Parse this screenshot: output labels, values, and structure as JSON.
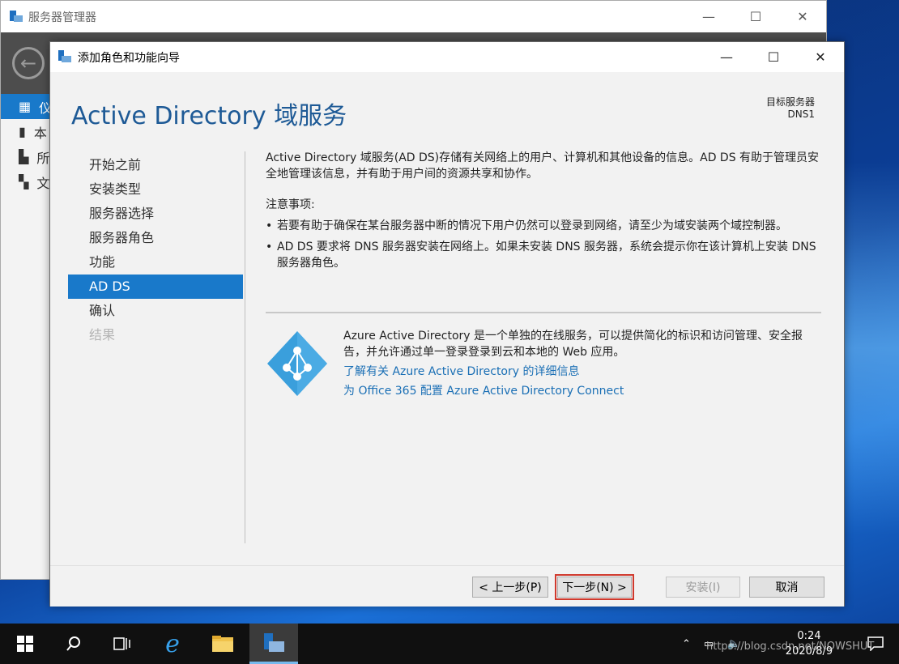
{
  "background_window": {
    "title": "服务器管理器",
    "sidebar_items": [
      "仪",
      "本",
      "所",
      "文"
    ]
  },
  "wizard": {
    "title": "添加角色和功能向导",
    "heading": "Active Directory 域服务",
    "target_label": "目标服务器",
    "target_value": "DNS1",
    "nav": [
      {
        "label": "开始之前",
        "state": "normal"
      },
      {
        "label": "安装类型",
        "state": "normal"
      },
      {
        "label": "服务器选择",
        "state": "normal"
      },
      {
        "label": "服务器角色",
        "state": "normal"
      },
      {
        "label": "功能",
        "state": "normal"
      },
      {
        "label": "AD DS",
        "state": "current"
      },
      {
        "label": "确认",
        "state": "normal"
      },
      {
        "label": "结果",
        "state": "disabled"
      }
    ],
    "intro": "Active Directory 域服务(AD DS)存储有关网络上的用户、计算机和其他设备的信息。AD DS 有助于管理员安全地管理该信息，并有助于用户间的资源共享和协作。",
    "notes_title": "注意事项:",
    "notes": [
      "若要有助于确保在某台服务器中断的情况下用户仍然可以登录到网络，请至少为域安装两个域控制器。",
      "AD DS 要求将 DNS 服务器安装在网络上。如果未安装 DNS 服务器，系统会提示你在该计算机上安装 DNS 服务器角色。"
    ],
    "azure_text": "Azure Active Directory 是一个单独的在线服务，可以提供简化的标识和访问管理、安全报告，并允许通过单一登录登录到云和本地的 Web 应用。",
    "azure_link1": "了解有关 Azure Active Directory 的详细信息",
    "azure_link2": "为 Office 365 配置 Azure Active Directory Connect",
    "buttons": {
      "prev": "< 上一步(P)",
      "next": "下一步(N) >",
      "install": "安装(I)",
      "cancel": "取消"
    }
  },
  "taskbar": {
    "time": "0:24",
    "date": "2020/8/9",
    "watermark": "https://blog.csdn.net/NOWSHUT"
  },
  "colors": {
    "accent": "#1979ca",
    "heading": "#1e5a96",
    "link": "#1a6fb5",
    "highlight": "#d03a2e"
  }
}
